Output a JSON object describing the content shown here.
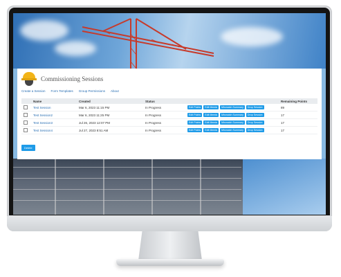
{
  "app": {
    "title": "Commissioning Sessions",
    "nav": [
      "Create a Session",
      "Form Templates",
      "Group Permissions",
      "About"
    ],
    "columns": [
      "Name",
      "Created",
      "Status",
      "",
      "Remaining Points"
    ],
    "row_buttons": [
      "Edit Points",
      "Edit Meeds",
      "Mismatch Summary",
      "Drop Session"
    ],
    "rows": [
      {
        "name": "Test Session",
        "created": "Mar 6, 2023 11:15 PM",
        "status": "In Progress",
        "remaining": "89"
      },
      {
        "name": "Test Session2",
        "created": "Mar 6, 2023 11:25 PM",
        "status": "In Progress",
        "remaining": "17"
      },
      {
        "name": "Test Session3",
        "created": "Jul 26, 2023 12:07 PM",
        "status": "In Progress",
        "remaining": "17"
      },
      {
        "name": "Test Session4",
        "created": "Jul 27, 2023 8:51 AM",
        "status": "In Progress",
        "remaining": "17"
      }
    ],
    "delete_label": "Delete"
  },
  "colors": {
    "accent": "#1e9be8",
    "link": "#2a6fb3",
    "logo": "#f2b418"
  }
}
